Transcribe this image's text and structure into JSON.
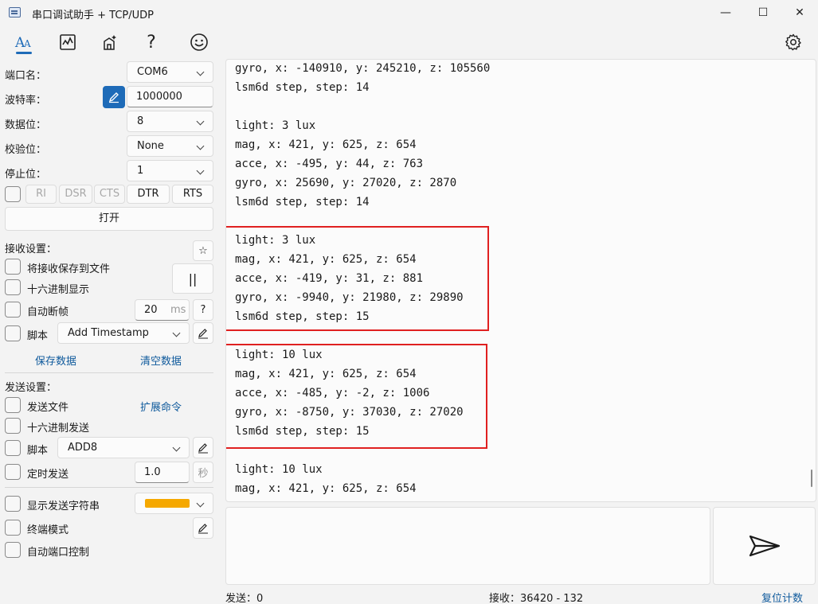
{
  "window": {
    "title": "串口调试助手 + TCP/UDP",
    "minimize": "—",
    "maximize": "☐",
    "close": "✕"
  },
  "toolbar": {
    "icons": [
      "font-icon",
      "chart-icon",
      "magic-icon",
      "help-icon",
      "smiley-icon",
      "settings-icon"
    ],
    "help_glyph": "?"
  },
  "serial": {
    "port_label": "端口名：",
    "port_value": "COM6",
    "baud_label": "波特率：",
    "baud_value": "1000000",
    "databits_label": "数据位：",
    "databits_value": "8",
    "parity_label": "校验位：",
    "parity_value": "None",
    "stopbits_label": "停止位：",
    "stopbits_value": "1",
    "signals": [
      "RI",
      "DSR",
      "CTS",
      "DTR",
      "RTS"
    ],
    "open_label": "打开"
  },
  "receive": {
    "section_label": "接收设置：",
    "save_to_file": "将接收保存到文件",
    "hex_display": "十六进制显示",
    "auto_frame": "自动断帧",
    "frame_value": "20",
    "frame_unit": "ms",
    "help": "?",
    "pause": "||",
    "star": "☆",
    "script_label": "脚本",
    "script_value": "Add Timestamp",
    "save_data": "保存数据",
    "clear_data": "清空数据"
  },
  "send": {
    "section_label": "发送设置：",
    "send_file": "发送文件",
    "extend_cmd": "扩展命令",
    "hex_send": "十六进制发送",
    "script_label": "脚本",
    "script_value": "ADD8",
    "timed_send": "定时发送",
    "timed_value": "1.0",
    "timed_unit": "秒",
    "show_send": "显示发送字符串",
    "show_color": "#f5a800",
    "terminal_mode": "终端模式",
    "auto_port": "自动端口控制"
  },
  "receive_log": [
    "gyro, x: -140910, y: 245210, z: 105560",
    "lsm6d step, step: 14",
    "",
    "light: 3 lux",
    "mag, x: 421, y: 625, z: 654",
    "acce, x: -495, y: 44, z: 763",
    "gyro, x: 25690, y: 27020, z: 2870",
    "lsm6d step, step: 14",
    "",
    "light: 3 lux",
    "mag, x: 421, y: 625, z: 654",
    "acce, x: -419, y: 31, z: 881",
    "gyro, x: -9940, y: 21980, z: 29890",
    "lsm6d step, step: 15",
    "",
    "light: 10 lux",
    "mag, x: 421, y: 625, z: 654",
    "acce, x: -485, y: -2, z: 1006",
    "gyro, x: -8750, y: 37030, z: 27020",
    "lsm6d step, step: 15",
    "",
    "light: 10 lux",
    "mag, x: 421, y: 625, z: 654"
  ],
  "status": {
    "sent": "发送：0",
    "received": "接收：36420  -  132",
    "reset": "复位计数"
  },
  "colors": {
    "accent": "#1e6bb8",
    "highlight": "#e02020"
  }
}
